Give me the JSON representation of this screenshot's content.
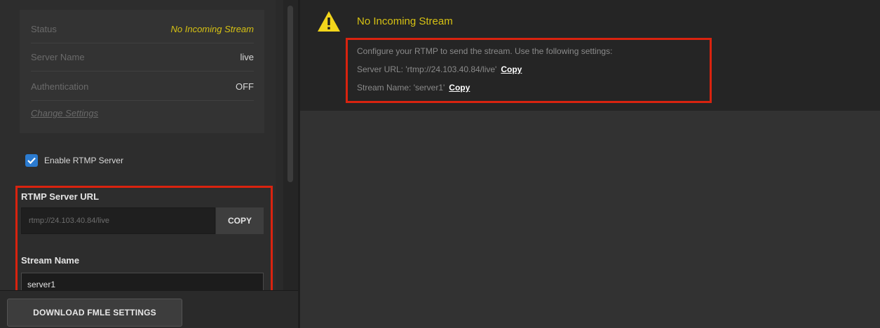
{
  "status_panel": {
    "rows": [
      {
        "label": "Status",
        "value": "No Incoming Stream"
      },
      {
        "label": "Server Name",
        "value": "live"
      },
      {
        "label": "Authentication",
        "value": "OFF"
      }
    ],
    "change_settings": "Change Settings"
  },
  "enable_rtmp": {
    "label": "Enable RTMP Server",
    "checked": true
  },
  "rtmp_url": {
    "label": "RTMP Server URL",
    "value": "rtmp://24.103.40.84/live",
    "copy_label": "COPY"
  },
  "stream_name": {
    "label": "Stream Name",
    "value": "server1"
  },
  "download_button": "DOWNLOAD FMLE SETTINGS",
  "notice": {
    "title": "No Incoming Stream",
    "line1": "Configure your RTMP to send the stream. Use the following settings:",
    "line2": "Server URL: 'rtmp://24.103.40.84/live'",
    "line3": "Stream Name: 'server1'",
    "copy_label": "Copy"
  },
  "icons": [
    "warning-icon",
    "check-icon"
  ],
  "colors": {
    "accent_yellow": "#d7c213",
    "highlight_red": "#d9230f",
    "checkbox_blue": "#2b7bd0"
  }
}
